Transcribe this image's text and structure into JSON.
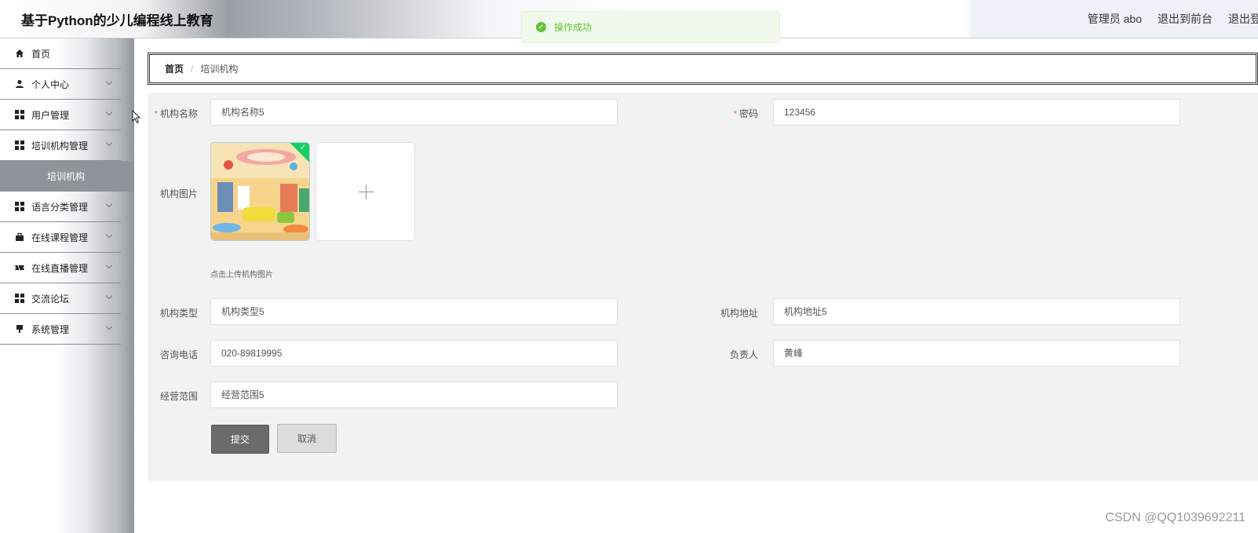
{
  "header": {
    "app_title": "基于Python的少儿编程线上教育",
    "user_label": "管理员 abo",
    "to_front": "退出到前台",
    "logout": "退出登录"
  },
  "toast": {
    "message": "操作成功",
    "type": "success"
  },
  "sidebar": {
    "items": [
      {
        "label": "首页",
        "icon": "home-icon",
        "has_children": false
      },
      {
        "label": "个人中心",
        "icon": "user-icon",
        "has_children": true
      },
      {
        "label": "用户管理",
        "icon": "grid-icon",
        "has_children": true
      },
      {
        "label": "培训机构管理",
        "icon": "grid-icon",
        "has_children": true
      },
      {
        "label": "语言分类管理",
        "icon": "grid-icon",
        "has_children": true
      },
      {
        "label": "在线课程管理",
        "icon": "briefcase-icon",
        "has_children": true
      },
      {
        "label": "在线直播管理",
        "icon": "ticket-icon",
        "has_children": true
      },
      {
        "label": "交流论坛",
        "icon": "grid-icon",
        "has_children": true
      },
      {
        "label": "系统管理",
        "icon": "flag-icon",
        "has_children": true
      }
    ],
    "active_sub_item": "培训机构"
  },
  "breadcrumb": {
    "home": "首页",
    "separator": "/",
    "current": "培训机构"
  },
  "form": {
    "name_label": "机构名称",
    "name_value": "机构名称5",
    "password_label": "密码",
    "password_value": "123456",
    "image_label": "机构图片",
    "image_hint": "点击上传机构图片",
    "type_label": "机构类型",
    "type_value": "机构类型5",
    "address_label": "机构地址",
    "address_value": "机构地址5",
    "phone_label": "咨询电话",
    "phone_value": "020-89819995",
    "manager_label": "负责人",
    "manager_value": "黄峰",
    "scope_label": "经营范围",
    "scope_value": "经营范围5",
    "submit_label": "提交",
    "cancel_label": "取消"
  },
  "watermark": "CSDN @QQ1039692211",
  "colors": {
    "success": "#67c23a",
    "required": "#f56c6c",
    "submit_bg": "#6b6b6b",
    "sidebar_active": "#8e949a"
  }
}
